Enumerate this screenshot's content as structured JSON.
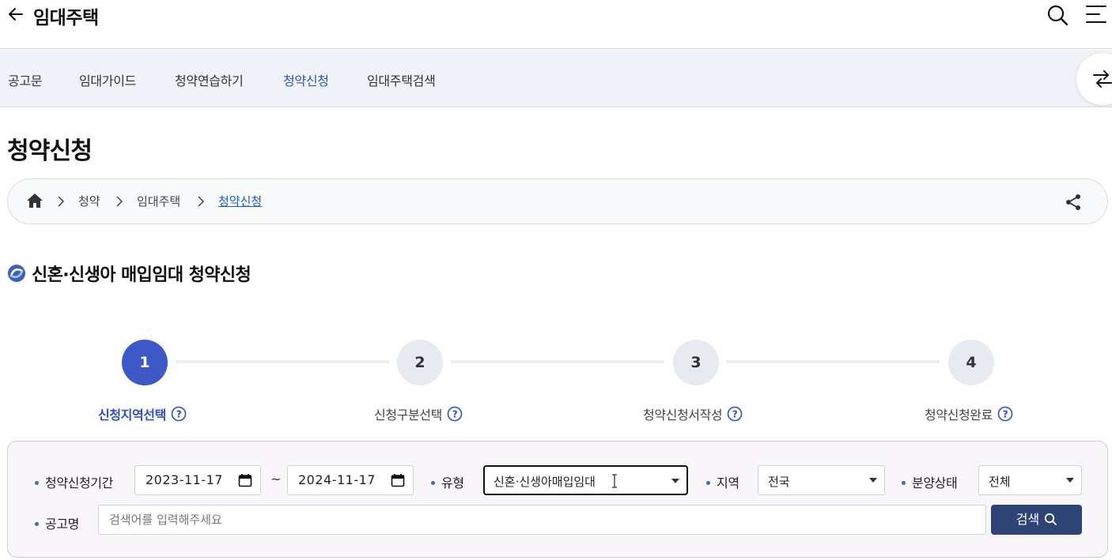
{
  "header": {
    "back_icon": "arrow-left-icon",
    "title": "임대주택",
    "search_icon": "search-icon",
    "menu_icon": "menu-icon"
  },
  "tabs": [
    {
      "label": "공고문",
      "active": false
    },
    {
      "label": "임대가이드",
      "active": false
    },
    {
      "label": "청약연습하기",
      "active": false
    },
    {
      "label": "청약신청",
      "active": true
    },
    {
      "label": "임대주택검색",
      "active": false
    }
  ],
  "page_title": "청약신청",
  "breadcrumb": {
    "home_icon": "home-icon",
    "items": [
      "청약",
      "임대주택",
      "청약신청"
    ],
    "share_icon": "share-icon"
  },
  "section_title": "신혼·신생아 매입임대 청약신청",
  "steps": [
    {
      "number": "1",
      "label": "신청지역선택",
      "active": true
    },
    {
      "number": "2",
      "label": "신청구분선택",
      "active": false
    },
    {
      "number": "3",
      "label": "청약신청서작성",
      "active": false
    },
    {
      "number": "4",
      "label": "청약신청완료",
      "active": false
    }
  ],
  "filters": {
    "period_label": "청약신청기간",
    "start_date": "2023-11-17",
    "range_separator": "~",
    "end_date": "2024-11-17",
    "type_label": "유형",
    "type_value": "신혼·신생아매입임대",
    "region_label": "지역",
    "region_value": "전국",
    "status_label": "분양상태",
    "status_value": "전체",
    "name_label": "공고명",
    "name_placeholder": "검색어를 입력해주세요",
    "name_value": "",
    "search_button": "검색"
  },
  "colors": {
    "accent": "#3f58c8",
    "active_tab": "#2d58b4",
    "search_button": "#2f4476",
    "breadcrumb_link": "#1a5fc4"
  }
}
